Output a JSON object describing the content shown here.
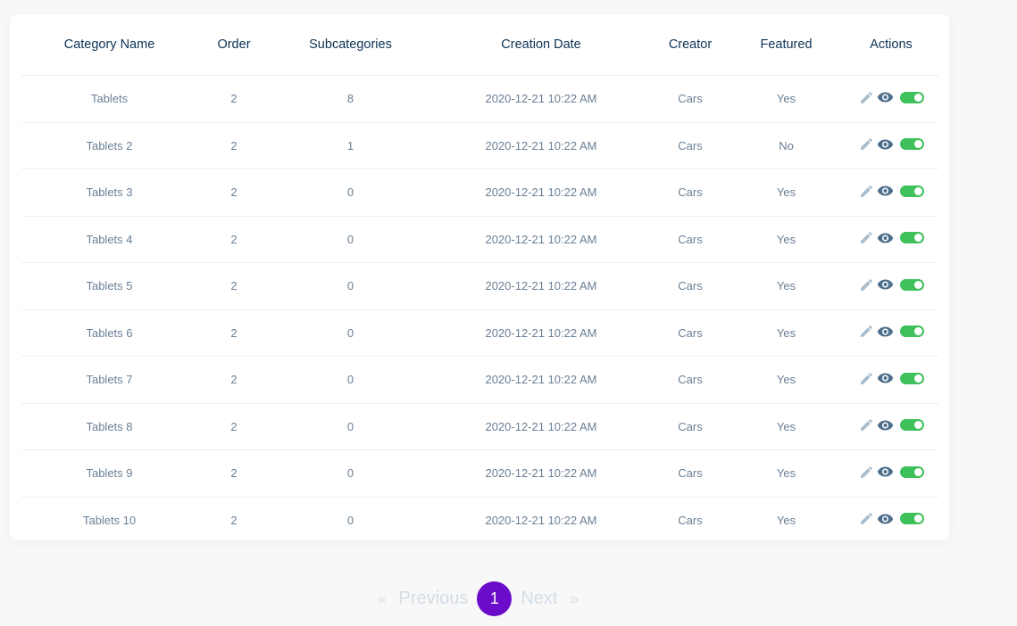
{
  "table": {
    "headers": [
      "Category Name",
      "Order",
      "Subcategories",
      "Creation Date",
      "Creator",
      "Featured",
      "Actions"
    ],
    "rows": [
      {
        "name": "Tablets",
        "order": "2",
        "subcategories": "8",
        "date": "2020-12-21 10:22 AM",
        "creator": "Cars",
        "featured": "Yes",
        "active": true
      },
      {
        "name": "Tablets 2",
        "order": "2",
        "subcategories": "1",
        "date": "2020-12-21 10:22 AM",
        "creator": "Cars",
        "featured": "No",
        "active": true
      },
      {
        "name": "Tablets 3",
        "order": "2",
        "subcategories": "0",
        "date": "2020-12-21 10:22 AM",
        "creator": "Cars",
        "featured": "Yes",
        "active": true
      },
      {
        "name": "Tablets 4",
        "order": "2",
        "subcategories": "0",
        "date": "2020-12-21 10:22 AM",
        "creator": "Cars",
        "featured": "Yes",
        "active": true
      },
      {
        "name": "Tablets 5",
        "order": "2",
        "subcategories": "0",
        "date": "2020-12-21 10:22 AM",
        "creator": "Cars",
        "featured": "Yes",
        "active": true
      },
      {
        "name": "Tablets 6",
        "order": "2",
        "subcategories": "0",
        "date": "2020-12-21 10:22 AM",
        "creator": "Cars",
        "featured": "Yes",
        "active": true
      },
      {
        "name": "Tablets 7",
        "order": "2",
        "subcategories": "0",
        "date": "2020-12-21 10:22 AM",
        "creator": "Cars",
        "featured": "Yes",
        "active": true
      },
      {
        "name": "Tablets 8",
        "order": "2",
        "subcategories": "0",
        "date": "2020-12-21 10:22 AM",
        "creator": "Cars",
        "featured": "Yes",
        "active": true
      },
      {
        "name": "Tablets 9",
        "order": "2",
        "subcategories": "0",
        "date": "2020-12-21 10:22 AM",
        "creator": "Cars",
        "featured": "Yes",
        "active": true
      },
      {
        "name": "Tablets 10",
        "order": "2",
        "subcategories": "0",
        "date": "2020-12-21 10:22 AM",
        "creator": "Cars",
        "featured": "Yes",
        "active": true
      }
    ],
    "action_icons": [
      "pencil-icon",
      "eye-icon",
      "toggle-switch"
    ]
  },
  "pagination": {
    "first_arrow": "«",
    "previous_label": "Previous",
    "current_page": "1",
    "next_label": "Next",
    "last_arrow": "»"
  },
  "colors": {
    "toggle_on": "#3ec05a",
    "current_page": "#6a0cc9",
    "header_text": "#0d3355",
    "cell_text": "#6a7f95"
  }
}
